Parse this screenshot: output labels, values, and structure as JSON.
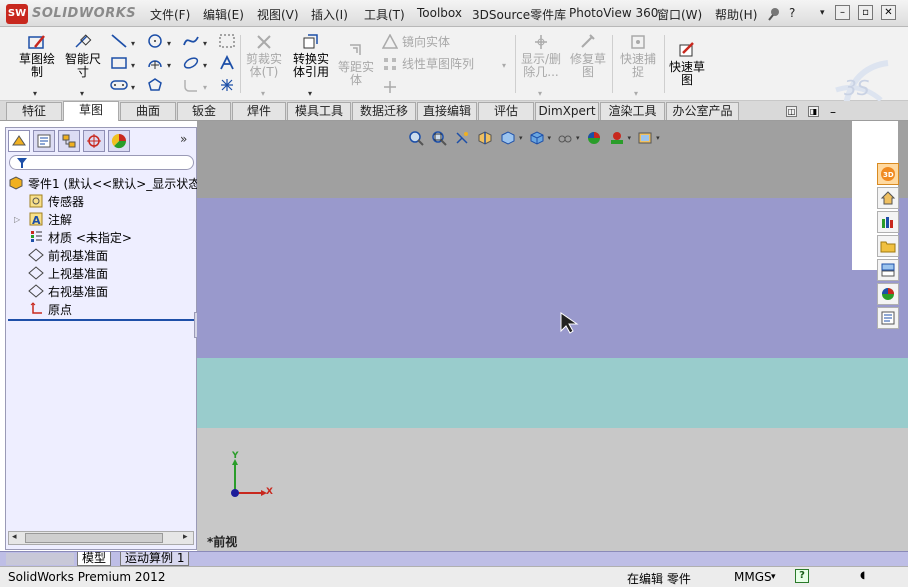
{
  "app": {
    "logo_mark": "SW",
    "logo_word": "SOLIDWORKS",
    "colors": {
      "accent_red": "#c8281e",
      "panel_bg": "#eeeeff",
      "band_gray": "#a0a0a0",
      "band_purple": "#9999cc",
      "band_teal": "#99cccc",
      "band_light": "#c8c8c8"
    }
  },
  "menu": {
    "items": [
      "文件(F)",
      "编辑(E)",
      "视图(V)",
      "插入(I)",
      "工具(T)",
      "Toolbox",
      "3DSource零件库",
      "PhotoView 360",
      "窗口(W)",
      "帮助(H)"
    ],
    "trailing": [
      "?",
      "▾"
    ]
  },
  "ribbon": {
    "sketch": "草图绘\n制",
    "smart_dim": "智能尺\n寸",
    "trim": "剪裁实\n体(T)",
    "convert": "转换实\n体引用",
    "offset": "等距实\n体",
    "mirror": "镜向实体",
    "linear_pattern": "线性草图阵列",
    "display_delete": "显示/删\n除几...",
    "repair": "修复草\n图",
    "quick_snap": "快速捕\n捉",
    "rapid_sketch": "快速草\n图"
  },
  "tabs": [
    "特征",
    "草图",
    "曲面",
    "钣金",
    "焊件",
    "模具工具",
    "数据迁移",
    "直接编辑",
    "评估",
    "DimXpert",
    "渲染工具",
    "办公室产品"
  ],
  "active_tab": "草图",
  "feature_tree": {
    "more": "»",
    "root": "零件1 (默认<<默认>_显示状态",
    "items": [
      "传感器",
      "注解",
      "材质 <未指定>",
      "前视基准面",
      "上视基准面",
      "右视基准面",
      "原点"
    ]
  },
  "viewport": {
    "view_name": "*前视",
    "triad": {
      "x": "X",
      "y": "Y"
    },
    "icons": [
      "zoom-to-fit-icon",
      "zoom-area-icon",
      "previous-view-icon",
      "section-view-icon",
      "view-orientation-icon",
      "display-style-icon",
      "hide-show-items-icon",
      "edit-appearance-icon",
      "apply-scene-icon",
      "view-settings-icon"
    ]
  },
  "task_pane": [
    "solidworks-resources-icon",
    "home-icon",
    "design-library-icon",
    "file-explorer-icon",
    "view-palette-icon",
    "appearances-icon",
    "custom-properties-icon"
  ],
  "bottom_tabs": [
    "模型",
    "运动算例 1"
  ],
  "active_bottom_tab": "模型",
  "status": {
    "product": "SolidWorks Premium 2012",
    "editing": "在编辑 零件",
    "units": "MMGS",
    "units_arrow": "▾",
    "help": "?"
  }
}
